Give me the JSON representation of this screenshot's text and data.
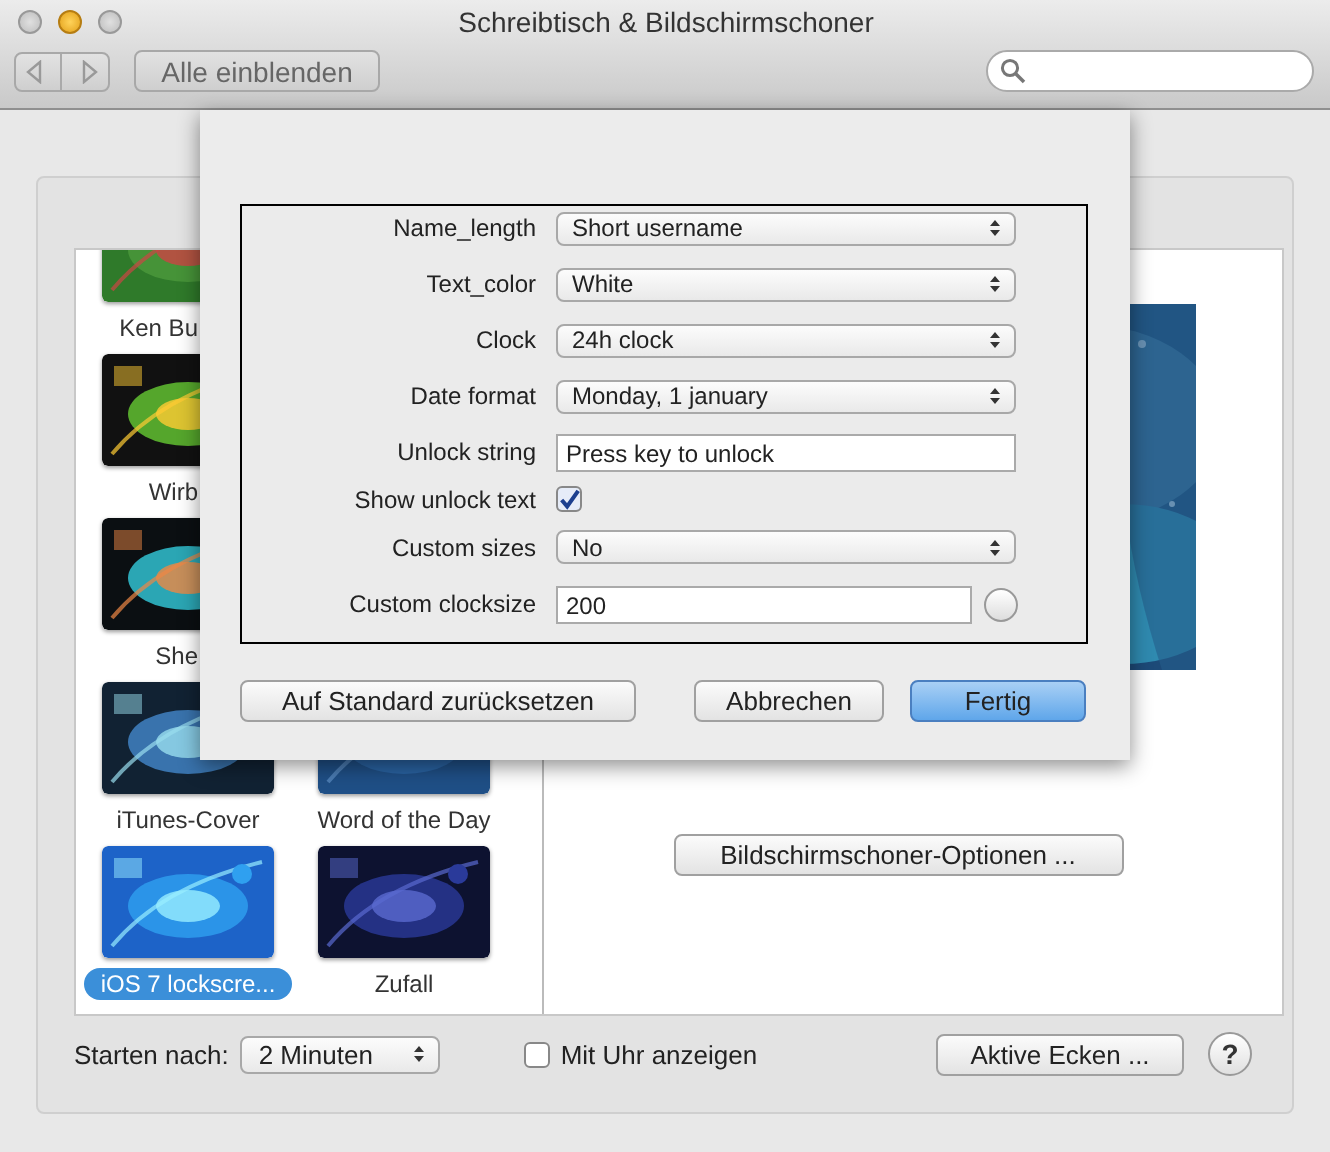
{
  "window": {
    "title": "Schreibtisch & Bildschirmschoner"
  },
  "toolbar": {
    "show_all_button": "Alle einblenden"
  },
  "screensaver_rows": [
    [
      {
        "label": "Ken Bu",
        "clipped": true,
        "selected": false
      }
    ],
    [
      {
        "label": "Wirb",
        "clipped": true,
        "selected": false
      }
    ],
    [
      {
        "label": "She",
        "clipped": true,
        "selected": false
      }
    ],
    [
      {
        "label": "iTunes-Cover",
        "clipped": false,
        "selected": false
      },
      {
        "label": "Word of the Day",
        "clipped": false,
        "selected": false
      }
    ],
    [
      {
        "label": "iOS 7 lockscre...",
        "clipped": false,
        "selected": true
      },
      {
        "label": "Zufall",
        "clipped": false,
        "selected": false
      }
    ]
  ],
  "options_button": "Bildschirmschoner-Optionen ...",
  "start_after": {
    "label": "Starten nach:",
    "value": "2 Minuten"
  },
  "show_clock": {
    "label": "Mit Uhr anzeigen",
    "checked": false
  },
  "hot_corners_button": "Aktive Ecken ...",
  "help_button": "?",
  "sheet": {
    "options": [
      {
        "kind": "select",
        "label": "Name_length",
        "value": "Short username"
      },
      {
        "kind": "select",
        "label": "Text_color",
        "value": "White"
      },
      {
        "kind": "select",
        "label": "Clock",
        "value": "24h clock"
      },
      {
        "kind": "select",
        "label": "Date format",
        "value": "Monday, 1 january"
      },
      {
        "kind": "text",
        "label": "Unlock string",
        "value": "Press key to unlock"
      },
      {
        "kind": "checkbox",
        "label": "Show unlock text",
        "checked": true
      },
      {
        "kind": "select",
        "label": "Custom sizes",
        "value": "No"
      },
      {
        "kind": "stepper",
        "label": "Custom clocksize",
        "value": "200"
      }
    ],
    "buttons": [
      {
        "label": "Auf Standard zurücksetzen",
        "default": false
      },
      {
        "label": "Abbrechen",
        "default": false
      },
      {
        "label": "Fertig",
        "default": true
      }
    ]
  }
}
